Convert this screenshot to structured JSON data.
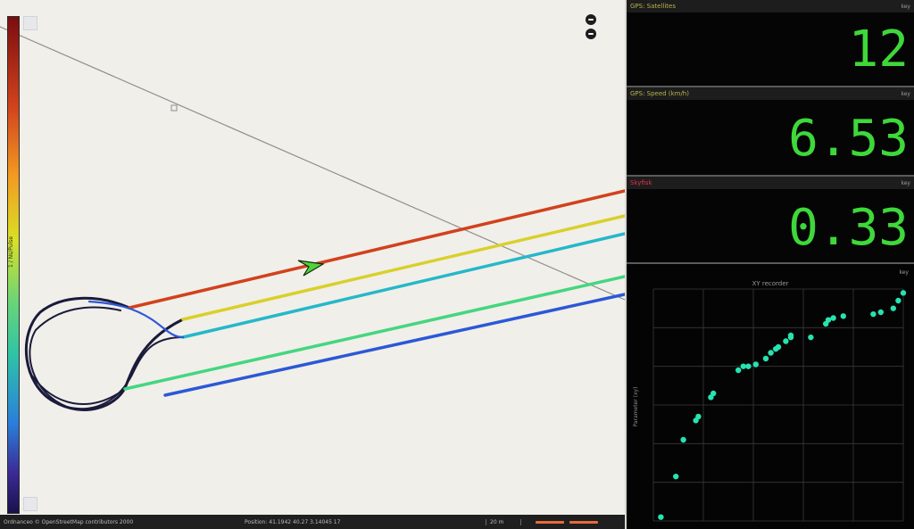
{
  "map": {
    "colorbar_label": "1 / Ns/Pulse",
    "path_arrow": "direction-arrow-icon",
    "status": {
      "attribution": "Ordnanceo © OpenStreetMap contributors 2000",
      "position": "Position: 41.1942 40.27 3.14045 17",
      "scale": "20 m"
    },
    "colors": {
      "track_dark": "#1a1a3a",
      "track_red": "#d1421d",
      "track_yellow": "#d9d02a",
      "track_cyan": "#25b8c8",
      "track_green": "#45d680",
      "track_blue": "#2b58d6",
      "grey_line": "#8e8e8e",
      "arrow": "#4fd43c"
    }
  },
  "panel": {
    "w1": {
      "title": "GPS: Satellites",
      "key": "key",
      "value": "12"
    },
    "w2": {
      "title": "GPS: Speed (km/h)",
      "key": "key",
      "value": "6.53"
    },
    "w3": {
      "title": "Skyfisk",
      "key": "key",
      "value": "0.33"
    },
    "w4": {
      "title": "XY recorder",
      "key": "key",
      "y_axis_label": "Parameter (xy)"
    }
  },
  "chart_data": {
    "type": "scatter",
    "title": "XY recorder",
    "xlabel": "",
    "ylabel": "Parameter (xy)",
    "points": [
      [
        0.03,
        0.02
      ],
      [
        0.09,
        0.23
      ],
      [
        0.12,
        0.42
      ],
      [
        0.17,
        0.52
      ],
      [
        0.18,
        0.54
      ],
      [
        0.23,
        0.64
      ],
      [
        0.24,
        0.66
      ],
      [
        0.34,
        0.78
      ],
      [
        0.36,
        0.8
      ],
      [
        0.38,
        0.8
      ],
      [
        0.41,
        0.81
      ],
      [
        0.45,
        0.84
      ],
      [
        0.47,
        0.87
      ],
      [
        0.49,
        0.89
      ],
      [
        0.5,
        0.9
      ],
      [
        0.53,
        0.93
      ],
      [
        0.55,
        0.95
      ],
      [
        0.55,
        0.96
      ],
      [
        0.63,
        0.95
      ],
      [
        0.69,
        1.02
      ],
      [
        0.7,
        1.04
      ],
      [
        0.72,
        1.05
      ],
      [
        0.76,
        1.06
      ],
      [
        0.88,
        1.07
      ],
      [
        0.91,
        1.08
      ],
      [
        0.96,
        1.1
      ],
      [
        0.98,
        1.14
      ],
      [
        1.0,
        1.18
      ]
    ],
    "xlim": [
      0,
      1.0
    ],
    "ylim": [
      0,
      1.2
    ],
    "grid": true,
    "point_color": "#26e3b0",
    "grid_color": "#3a3a3a"
  }
}
